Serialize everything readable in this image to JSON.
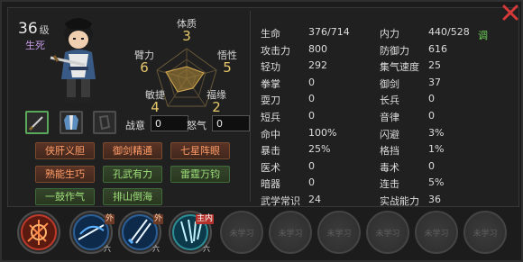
{
  "character": {
    "level": "36",
    "level_unit": "级",
    "state": "生死"
  },
  "radar": {
    "top": {
      "label": "体质",
      "value": "3"
    },
    "upper_left": {
      "label": "臂力",
      "value": "6"
    },
    "upper_right": {
      "label": "悟性",
      "value": "5"
    },
    "lower_left": {
      "label": "敏捷",
      "value": "4"
    },
    "lower_right": {
      "label": "福缘",
      "value": "2"
    }
  },
  "fields": {
    "zhanyi_label": "战意",
    "zhanyi_value": "0",
    "nuqi_label": "怒气",
    "nuqi_value": "0"
  },
  "tags": [
    {
      "label": "侠肝义胆",
      "color": "orange"
    },
    {
      "label": "御剑精通",
      "color": "orange"
    },
    {
      "label": "七星阵眼",
      "color": "orange"
    },
    {
      "label": "熟能生巧",
      "color": "orange"
    },
    {
      "label": "孔武有力",
      "color": "green"
    },
    {
      "label": "雷霆万钧",
      "color": "green"
    },
    {
      "label": "一鼓作气",
      "color": "green"
    },
    {
      "label": "排山倒海",
      "color": "green"
    }
  ],
  "stats_left": [
    {
      "label": "生命",
      "value": "376/714"
    },
    {
      "label": "攻击力",
      "value": "800"
    },
    {
      "label": "轻功",
      "value": "292"
    },
    {
      "label": "拳掌",
      "value": "0"
    },
    {
      "label": "耍刀",
      "value": "0"
    },
    {
      "label": "短兵",
      "value": "0"
    },
    {
      "label": "命中",
      "value": "100%"
    },
    {
      "label": "暴击",
      "value": "25%"
    },
    {
      "label": "医术",
      "value": "0"
    },
    {
      "label": "暗器",
      "value": "0"
    },
    {
      "label": "武学常识",
      "value": "24"
    }
  ],
  "stats_right": [
    {
      "label": "内力",
      "value": "440/528"
    },
    {
      "label": "防御力",
      "value": "616"
    },
    {
      "label": "集气速度",
      "value": "25"
    },
    {
      "label": "御剑",
      "value": "37"
    },
    {
      "label": "长兵",
      "value": "0"
    },
    {
      "label": "音律",
      "value": "0"
    },
    {
      "label": "闪避",
      "value": "3%"
    },
    {
      "label": "格挡",
      "value": "1%"
    },
    {
      "label": "毒术",
      "value": "0"
    },
    {
      "label": "连击",
      "value": "5%"
    },
    {
      "label": "实战能力",
      "value": "36"
    }
  ],
  "tune_label": "调",
  "close_icon": "close-icon",
  "skills": [
    {
      "name": "sword-array-icon",
      "badge": "",
      "sub": ""
    },
    {
      "name": "sword-slash-icon",
      "badge": "外",
      "sub": "六"
    },
    {
      "name": "twin-swords-icon",
      "badge": "外",
      "sub": "六"
    },
    {
      "name": "sword-rain-icon",
      "badge": "主内",
      "sub": "六"
    }
  ],
  "empty_slot_label": "未学习",
  "empty_slot_count": 7,
  "colors": {
    "orange_tag": "#ff9b66",
    "green_tag": "#9fe07a",
    "radar_value": "#e6c76a",
    "close": "#d43a3a"
  }
}
